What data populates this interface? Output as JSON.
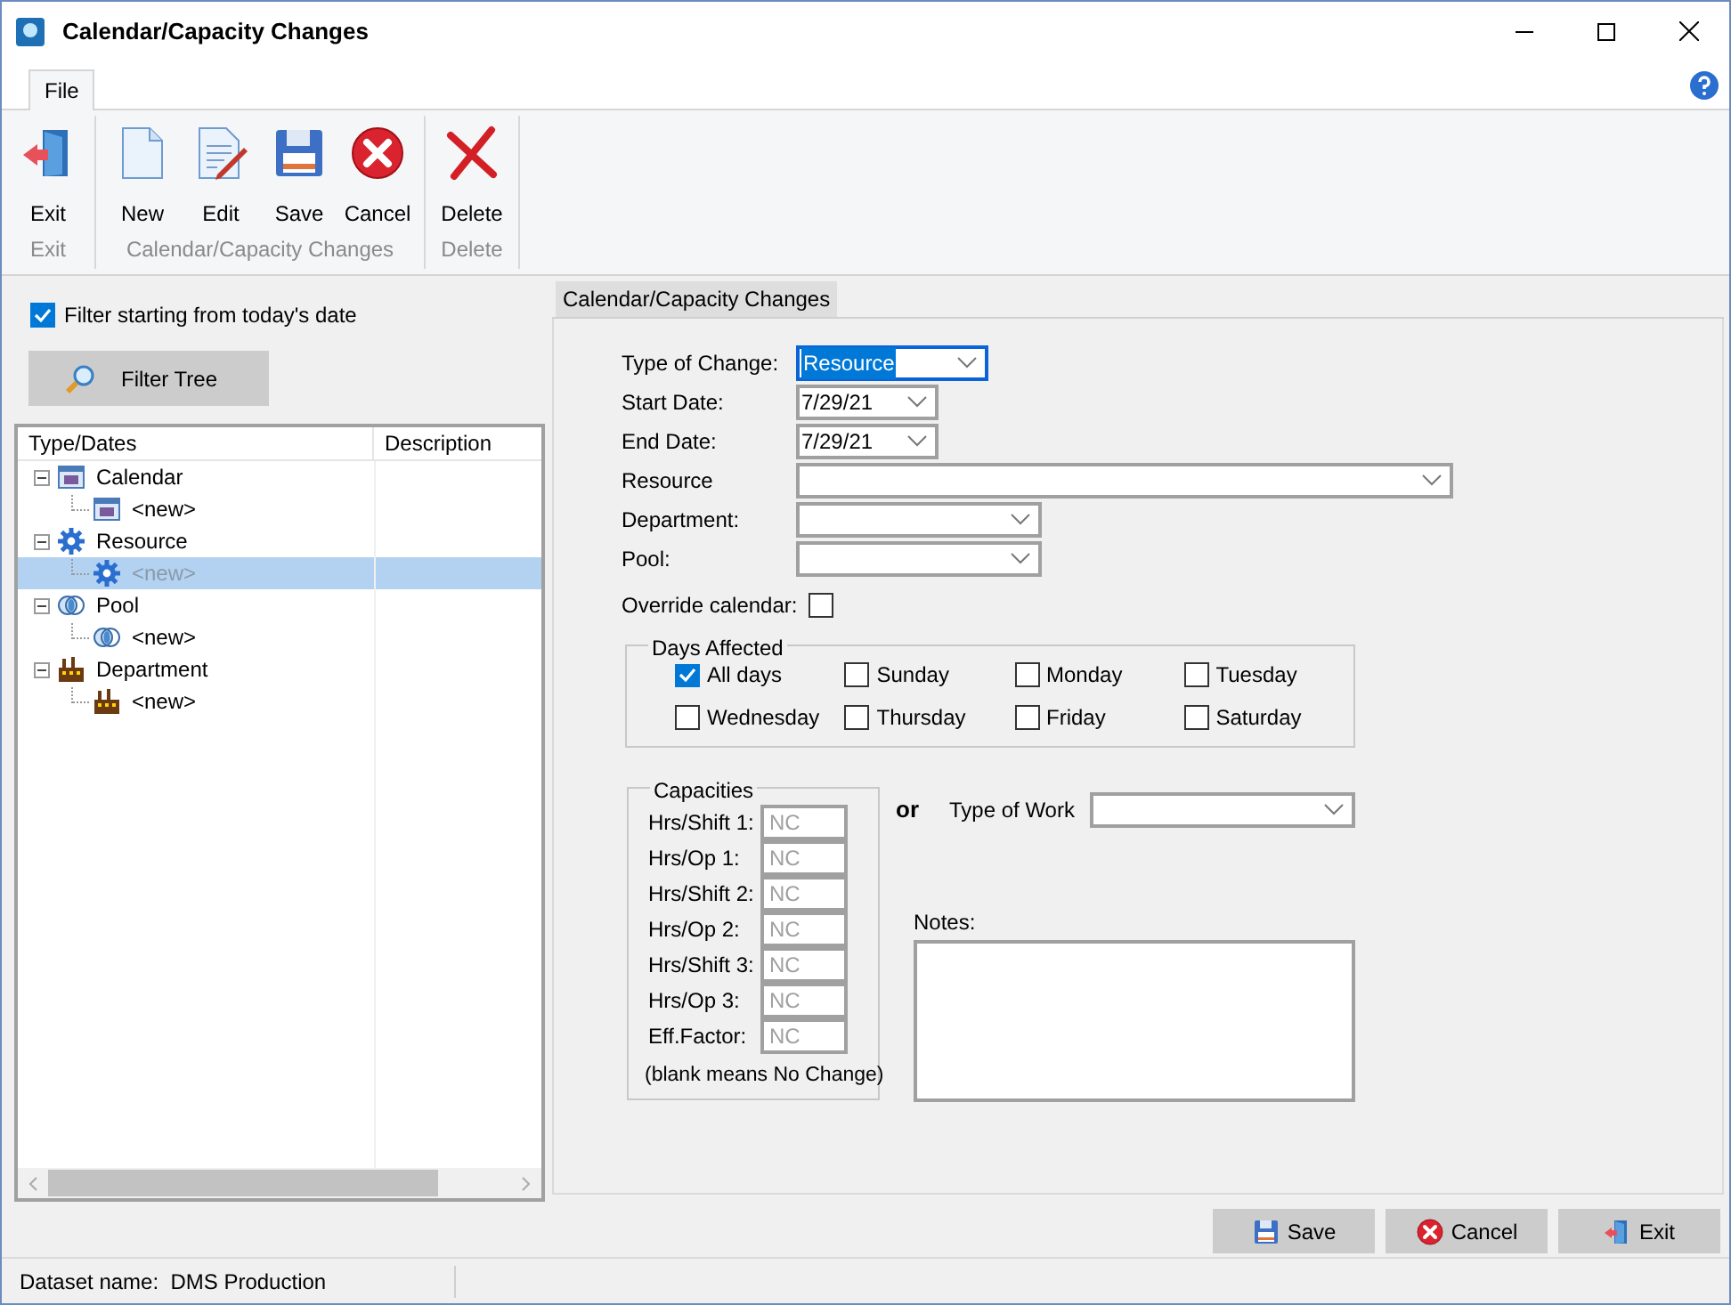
{
  "window": {
    "title": "Calendar/Capacity Changes"
  },
  "menu_tabs": [
    {
      "label": "File",
      "selected": true
    }
  ],
  "ribbon_groups": [
    {
      "label": "Exit",
      "buttons": [
        {
          "label": "Exit",
          "kind": "exit"
        }
      ]
    },
    {
      "label": "Calendar/Capacity Changes",
      "buttons": [
        {
          "label": "New",
          "kind": "new"
        },
        {
          "label": "Edit",
          "kind": "edit"
        },
        {
          "label": "Save",
          "kind": "save"
        },
        {
          "label": "Cancel",
          "kind": "cancel"
        }
      ]
    },
    {
      "label": "Delete",
      "buttons": [
        {
          "label": "Delete",
          "kind": "delete"
        }
      ]
    }
  ],
  "filter": {
    "label": "Filter starting from today's date",
    "checked": true
  },
  "filter_button": {
    "label": "Filter Tree"
  },
  "tree": {
    "columns": [
      "Type/Dates",
      "Description"
    ],
    "items": [
      {
        "label": "Calendar",
        "kind": "calendar",
        "expanded": true,
        "selected": false,
        "children": [
          {
            "label": "<new>",
            "kind": "calendar",
            "selected": false
          }
        ]
      },
      {
        "label": "Resource",
        "kind": "gear",
        "expanded": true,
        "selected": false,
        "children": [
          {
            "label": "<new>",
            "kind": "gear",
            "selected": true
          }
        ]
      },
      {
        "label": "Pool",
        "kind": "pool",
        "expanded": true,
        "selected": false,
        "children": [
          {
            "label": "<new>",
            "kind": "pool",
            "selected": false
          }
        ]
      },
      {
        "label": "Department",
        "kind": "factory",
        "expanded": true,
        "selected": false,
        "children": [
          {
            "label": "<new>",
            "kind": "factory",
            "selected": false
          }
        ]
      }
    ]
  },
  "form": {
    "tab": {
      "label": "Calendar/Capacity Changes",
      "selected": true
    },
    "fields": [
      {
        "label": "Type of Change:",
        "value": "Resource",
        "focused": true
      },
      {
        "label": "Start Date:",
        "value": "7/29/21",
        "focused": false
      },
      {
        "label": "End Date:",
        "value": "7/29/21",
        "focused": false
      },
      {
        "label": "Resource",
        "focused": false
      },
      {
        "label": "Department:",
        "focused": false
      },
      {
        "label": "Pool:",
        "focused": false
      }
    ],
    "override": {
      "label": "Override calendar:",
      "checked": false
    },
    "days_affected": {
      "title": "Days Affected",
      "days": [
        {
          "label": "All days",
          "checked": true
        },
        {
          "label": "Sunday",
          "checked": false
        },
        {
          "label": "Monday",
          "checked": false
        },
        {
          "label": "Tuesday",
          "checked": false
        },
        {
          "label": "Wednesday",
          "checked": false
        },
        {
          "label": "Thursday",
          "checked": false
        },
        {
          "label": "Friday",
          "checked": false
        },
        {
          "label": "Saturday",
          "checked": false
        }
      ]
    },
    "capacities": {
      "title": "Capacities",
      "fields": [
        {
          "label": "Hrs/Shift 1:",
          "placeholder": "NC"
        },
        {
          "label": "Hrs/Op 1:",
          "placeholder": "NC"
        },
        {
          "label": "Hrs/Shift 2:",
          "placeholder": "NC"
        },
        {
          "label": "Hrs/Op 2:",
          "placeholder": "NC"
        },
        {
          "label": "Hrs/Shift 3:",
          "placeholder": "NC"
        },
        {
          "label": "Hrs/Op 3:",
          "placeholder": "NC"
        },
        {
          "label": "Eff.Factor:",
          "placeholder": "NC"
        }
      ],
      "note": "(blank means No Change)"
    },
    "or_label": "or",
    "type_of_work": {
      "label": "Type of Work"
    },
    "notes": {
      "label": "Notes:"
    }
  },
  "footer_buttons": [
    {
      "label": "Save",
      "kind": "save"
    },
    {
      "label": "Cancel",
      "kind": "cancel"
    },
    {
      "label": "Exit",
      "kind": "exit"
    }
  ],
  "status_bar": {
    "text": "Dataset name:  DMS Production"
  }
}
